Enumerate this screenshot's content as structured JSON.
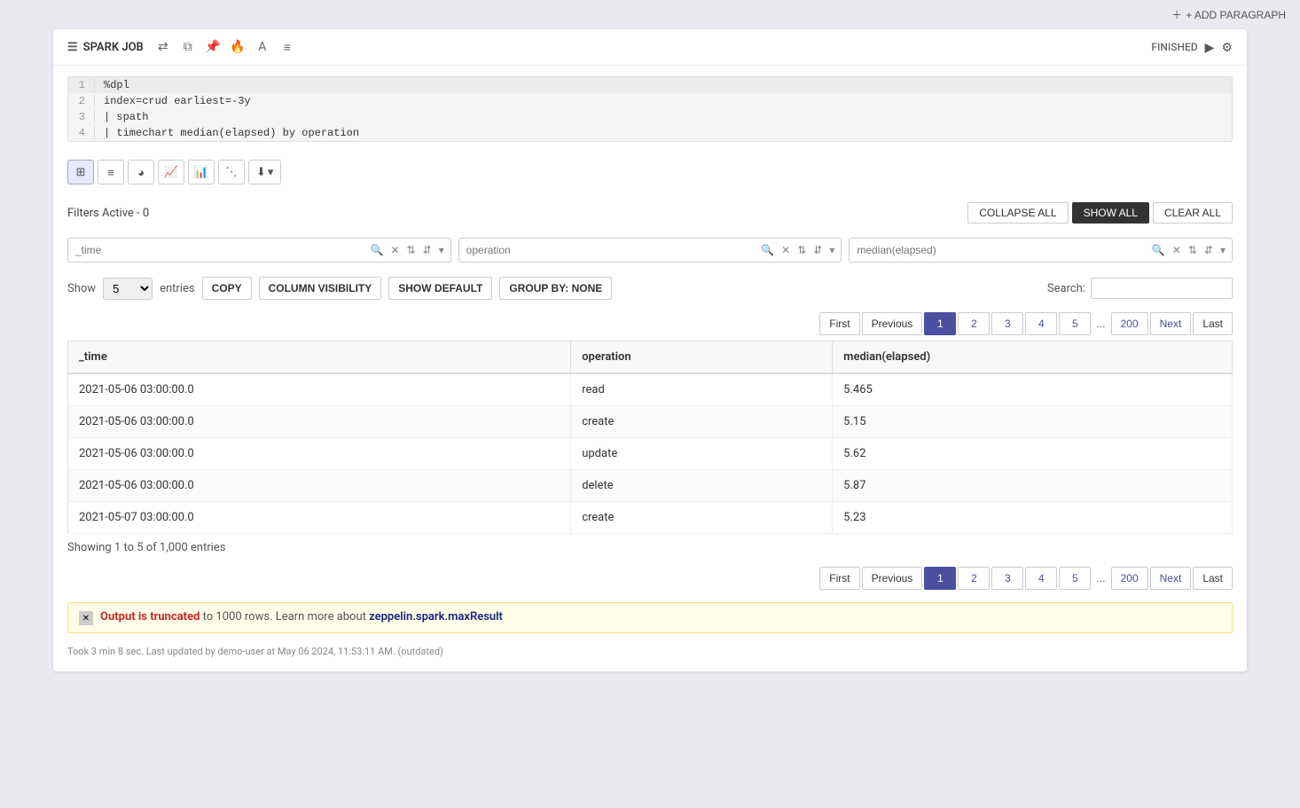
{
  "topbar": {
    "add_paragraph": "+ ADD PARAGRAPH"
  },
  "cell": {
    "title": "SPARK JOB",
    "status": "FINISHED",
    "code_lines": [
      {
        "num": 1,
        "content": "%dpl"
      },
      {
        "num": 2,
        "content": "index=crud earliest=-3y"
      },
      {
        "num": 3,
        "content": "| spath"
      },
      {
        "num": 4,
        "content": "| timechart median(elapsed) by operation"
      }
    ]
  },
  "viz_icons": [
    "table",
    "list",
    "pie",
    "line",
    "bar",
    "scatter",
    "download"
  ],
  "filters": {
    "label": "Filters Active - 0",
    "collapse_all": "COLLAPSE ALL",
    "show_all": "SHOW ALL",
    "clear_all": "CLEAR ALL"
  },
  "column_filters": [
    {
      "placeholder": "_time"
    },
    {
      "placeholder": "operation"
    },
    {
      "placeholder": "median(elapsed)"
    }
  ],
  "table_controls": {
    "show_label": "Show",
    "show_value": "5",
    "entries_label": "entries",
    "copy_btn": "COPY",
    "column_visibility_btn": "COLUMN VISIBILITY",
    "show_default_btn": "SHOW DEFAULT",
    "group_by_btn": "GROUP BY: NONE",
    "search_label": "Search:"
  },
  "pagination_top": {
    "first": "First",
    "previous": "Previous",
    "pages": [
      "1",
      "2",
      "3",
      "4",
      "5",
      "...",
      "200"
    ],
    "next": "Next",
    "last": "Last",
    "active_page": "1"
  },
  "pagination_bottom": {
    "first": "First",
    "previous": "Previous",
    "pages": [
      "1",
      "2",
      "3",
      "4",
      "5",
      "...",
      "200"
    ],
    "next": "Next",
    "last": "Last",
    "active_page": "1"
  },
  "table": {
    "columns": [
      "_time",
      "operation",
      "median(elapsed)"
    ],
    "rows": [
      [
        "2021-05-06 03:00:00.0",
        "read",
        "5.465"
      ],
      [
        "2021-05-06 03:00:00.0",
        "create",
        "5.15"
      ],
      [
        "2021-05-06 03:00:00.0",
        "update",
        "5.62"
      ],
      [
        "2021-05-06 03:00:00.0",
        "delete",
        "5.87"
      ],
      [
        "2021-05-07 03:00:00.0",
        "create",
        "5.23"
      ]
    ]
  },
  "showing_info": "Showing 1 to 5 of 1,000 entries",
  "truncated_warning": {
    "bold_text": "Output is truncated",
    "text": " to 1000 rows. Learn more about ",
    "link_text": "zeppelin.spark.maxResult",
    "link_href": "#"
  },
  "footer": {
    "text": "Took 3 min 8 sec. Last updated by demo-user at May 06 2024, 11:53:11 AM. (outdated)"
  }
}
